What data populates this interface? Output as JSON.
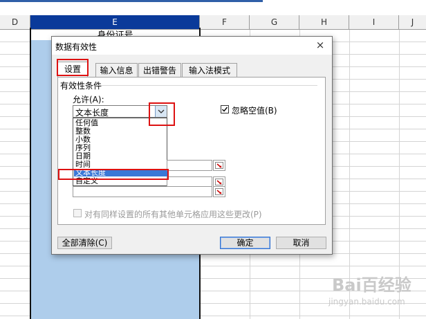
{
  "columns": [
    "D",
    "E",
    "F",
    "G",
    "H",
    "I",
    "J"
  ],
  "cell_e1": "身份证号",
  "dialog": {
    "title": "数据有效性",
    "close_glyph": "×",
    "tabs": [
      "设置",
      "输入信息",
      "出错警告",
      "输入法模式"
    ],
    "active_tab": "设置",
    "group_title": "有效性条件",
    "allow_label": "允许(A):",
    "allow_value": "文本长度",
    "allow_options": [
      "任何值",
      "整数",
      "小数",
      "序列",
      "日期",
      "时间",
      "文本长度",
      "自定义"
    ],
    "selected_option": "文本长度",
    "ignore_blank_label": "忽略空值(B)",
    "ignore_blank_checked": true,
    "apply_all_label": "对有同样设置的所有其他单元格应用这些更改(P)",
    "apply_all_checked": false,
    "buttons": {
      "clear_all": "全部清除(C)",
      "ok": "确定",
      "cancel": "取消"
    }
  },
  "watermark": {
    "text": "Bai百经验",
    "sub": "jingyan.baidu.com"
  },
  "colors": {
    "selected_header": "#0a3a9a",
    "selected_column": "#aecdeb",
    "highlight_box": "#dd1111",
    "list_selection": "#3a78d6"
  }
}
